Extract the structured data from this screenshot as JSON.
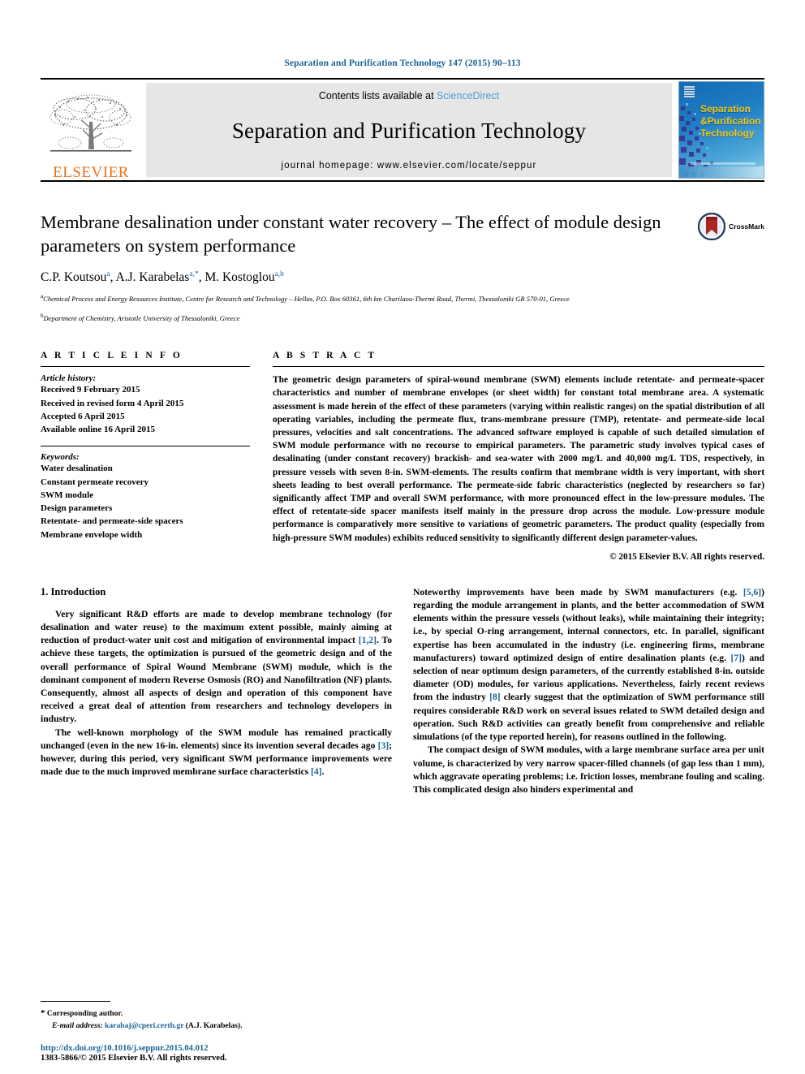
{
  "running_head": "Separation and Purification Technology 147 (2015) 90–113",
  "masthead": {
    "publisher_name": "ELSEVIER",
    "contents_prefix": "Contents lists available at",
    "contents_link": "ScienceDirect",
    "journal_name": "Separation and Purification Technology",
    "homepage": "journal homepage: www.elsevier.com/locate/seppur",
    "cover_title_line1": "Separation",
    "cover_title_line2": "Purification",
    "cover_title_line3": "Technology",
    "cover_amp": "&"
  },
  "article": {
    "title": "Membrane desalination under constant water recovery – The effect of module design parameters on system performance",
    "crossmark_label": "CrossMark",
    "authors_html": "C.P. Koutsou",
    "authors": [
      {
        "name": "C.P. Koutsou",
        "marks": "a"
      },
      {
        "name": "A.J. Karabelas",
        "marks": "a,*"
      },
      {
        "name": "M. Kostoglou",
        "marks": "a,b"
      }
    ],
    "affiliations": [
      {
        "mark": "a",
        "text": "Chemical Process and Energy Resources Institute, Centre for Research and Technology – Hellas, P.O. Box 60361, 6th km Charilaou-Thermi Road, Thermi, Thessaloniki GR 570-01, Greece"
      },
      {
        "mark": "b",
        "text": "Department of Chemistry, Aristotle University of Thessaloniki, Greece"
      }
    ]
  },
  "article_info": {
    "heading": "A R T I C L E    I N F O",
    "history_label": "Article history:",
    "history": [
      "Received 9 February 2015",
      "Received in revised form 4 April 2015",
      "Accepted 6 April 2015",
      "Available online 16 April 2015"
    ],
    "keywords_label": "Keywords:",
    "keywords": [
      "Water desalination",
      "Constant permeate recovery",
      "SWM module",
      "Design parameters",
      "Retentate- and permeate-side spacers",
      "Membrane envelope width"
    ]
  },
  "abstract": {
    "heading": "A B S T R A C T",
    "text": "The geometric design parameters of spiral-wound membrane (SWM) elements include retentate- and permeate-spacer characteristics and number of membrane envelopes (or sheet width) for constant total membrane area. A systematic assessment is made herein of the effect of these parameters (varying within realistic ranges) on the spatial distribution of all operating variables, including the permeate flux, trans-membrane pressure (TMP), retentate- and permeate-side local pressures, velocities and salt concentrations. The advanced software employed is capable of such detailed simulation of SWM module performance with no recourse to empirical parameters. The parametric study involves typical cases of desalinating (under constant recovery) brackish- and sea-water with 2000 mg/L and 40,000 mg/L TDS, respectively, in pressure vessels with seven 8-in. SWM-elements. The results confirm that membrane width is very important, with short sheets leading to best overall performance. The permeate-side fabric characteristics (neglected by researchers so far) significantly affect TMP and overall SWM performance, with more pronounced effect in the low-pressure modules. The effect of retentate-side spacer manifests itself mainly in the pressure drop across the module. Low-pressure module performance is comparatively more sensitive to variations of geometric parameters. The product quality (especially from high-pressure SWM modules) exhibits reduced sensitivity to significantly different design parameter-values.",
    "copyright": "© 2015 Elsevier B.V. All rights reserved."
  },
  "body": {
    "section_number_title": "1. Introduction",
    "left_paragraphs": [
      "Very significant R&D efforts are made to develop membrane technology (for desalination and water reuse) to the maximum extent possible, mainly aiming at reduction of product-water unit cost and mitigation of environmental impact [1,2]. To achieve these targets, the optimization is pursued of the geometric design and of the overall performance of Spiral Wound Membrane (SWM) module, which is the dominant component of modern Reverse Osmosis (RO) and Nanofiltration (NF) plants. Consequently, almost all aspects of design and operation of this component have received a great deal of attention from researchers and technology developers in industry.",
      "The well-known morphology of the SWM module has remained practically unchanged (even in the new 16-in. elements) since its invention several decades ago [3]; however, during this period, very significant SWM performance improvements were made due to the much improved membrane surface characteristics [4]."
    ],
    "right_paragraphs": [
      "Noteworthy improvements have been made by SWM manufacturers (e.g. [5,6]) regarding the module arrangement in plants, and the better accommodation of SWM elements within the pressure vessels (without leaks), while maintaining their integrity; i.e., by special O-ring arrangement, internal connectors, etc. In parallel, significant expertise has been accumulated in the industry (i.e. engineering firms, membrane manufacturers) toward optimized design of entire desalination plants (e.g. [7]) and selection of near optimum design parameters, of the currently established 8-in. outside diameter (OD) modules, for various applications. Nevertheless, fairly recent reviews from the industry [8] clearly suggest that the optimization of SWM performance still requires considerable R&D work on several issues related to SWM detailed design and operation. Such R&D activities can greatly benefit from comprehensive and reliable simulations (of the type reported herein), for reasons outlined in the following.",
      "The compact design of SWM modules, with a large membrane surface area per unit volume, is characterized by very narrow spacer-filled channels (of gap less than 1 mm), which aggravate operating problems; i.e. friction losses, membrane fouling and scaling. This complicated design also hinders experimental and"
    ]
  },
  "footnotes": {
    "corresponding": "Corresponding author.",
    "email_label": "E-mail address:",
    "email": "karabaj@cperi.certh.gr",
    "email_suffix": "(A.J. Karabelas)."
  },
  "footer": {
    "doi": "http://dx.doi.org/10.1016/j.seppur.2015.04.012",
    "issn_line": "1383-5866/© 2015 Elsevier B.V. All rights reserved."
  },
  "colors": {
    "link_blue": "#1a6496",
    "elsevier_orange": "#E9711C",
    "sciencedirect_blue": "#4a9fd4",
    "cover_gold": "#f5c518"
  }
}
